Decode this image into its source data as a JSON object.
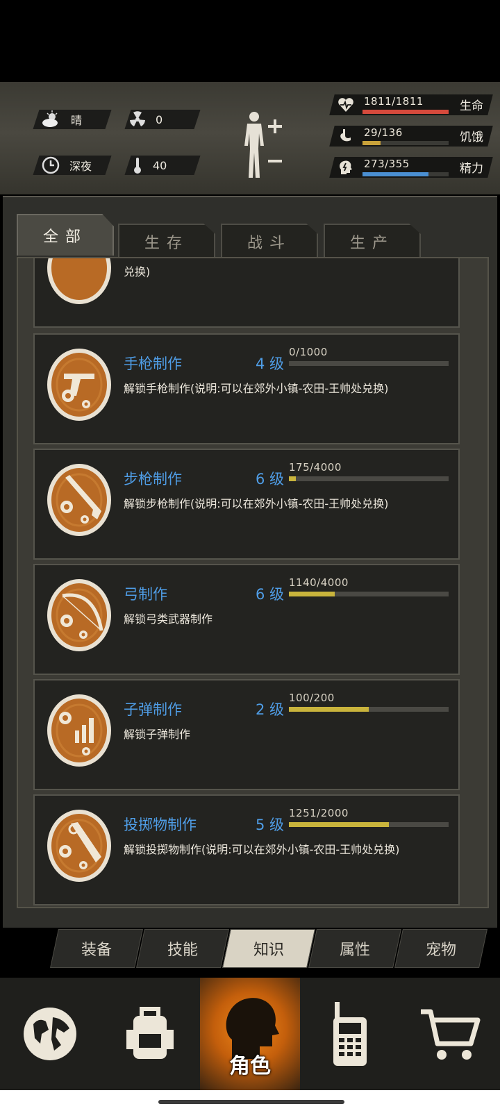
{
  "header": {
    "weather": {
      "icon": "cloud-sun-icon",
      "label": "晴"
    },
    "radiation": {
      "icon": "radiation-icon",
      "value": "0"
    },
    "time": {
      "icon": "clock-icon",
      "label": "深夜"
    },
    "temperature": {
      "icon": "thermometer-icon",
      "value": "40"
    },
    "stats": [
      {
        "icon": "heart-icon",
        "value": "1811/1811",
        "label": "生命",
        "fill": 1.0,
        "color": "#d64a3c"
      },
      {
        "icon": "stomach-icon",
        "value": "29/136",
        "label": "饥饿",
        "fill": 0.21,
        "color": "#c9a23a"
      },
      {
        "icon": "brain-icon",
        "value": "273/355",
        "label": "精力",
        "fill": 0.77,
        "color": "#4a8fd2"
      }
    ]
  },
  "tabs": [
    "全部",
    "生存",
    "战斗",
    "生产"
  ],
  "active_tab": 0,
  "partial_card": {
    "desc": "兑换)"
  },
  "knowledge": [
    {
      "title": "手枪制作",
      "level": "4 级",
      "progress": "0/1000",
      "fill": 0.0,
      "desc": "解锁手枪制作(说明:可以在郊外小镇-农田-王帅处兑换)",
      "icon": "pistol-gear-icon"
    },
    {
      "title": "步枪制作",
      "level": "6 级",
      "progress": "175/4000",
      "fill": 0.04375,
      "desc": "解锁步枪制作(说明:可以在郊外小镇-农田-王帅处兑换)",
      "icon": "rifle-gear-icon"
    },
    {
      "title": "弓制作",
      "level": "6 级",
      "progress": "1140/4000",
      "fill": 0.285,
      "desc": "解锁弓类武器制作",
      "icon": "bow-gear-icon"
    },
    {
      "title": "子弹制作",
      "level": "2 级",
      "progress": "100/200",
      "fill": 0.5,
      "desc": "解锁子弹制作",
      "icon": "bullets-gear-icon"
    },
    {
      "title": "投掷物制作",
      "level": "5 级",
      "progress": "1251/2000",
      "fill": 0.6255,
      "desc": "解锁投掷物制作(说明:可以在郊外小镇-农田-王帅处兑换)",
      "icon": "grenade-gear-icon"
    }
  ],
  "subtabs": [
    "装备",
    "技能",
    "知识",
    "属性",
    "宠物"
  ],
  "active_subtab": 2,
  "nav": [
    {
      "icon": "globe-icon",
      "label": ""
    },
    {
      "icon": "backpack-icon",
      "label": ""
    },
    {
      "icon": "head-silhouette-icon",
      "label": "角色"
    },
    {
      "icon": "walkie-talkie-icon",
      "label": ""
    },
    {
      "icon": "shopping-cart-icon",
      "label": ""
    }
  ]
}
